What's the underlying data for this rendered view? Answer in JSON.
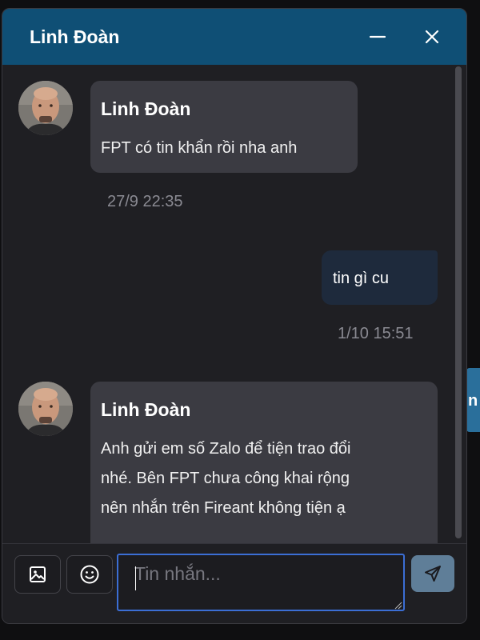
{
  "header": {
    "title": "Linh Đoàn",
    "minimize_icon": "minimize-icon",
    "close_icon": "close-icon"
  },
  "messages": [
    {
      "direction": "incoming",
      "sender": "Linh Đoàn",
      "lines": [
        "FPT có tin khẩn rồi nha anh"
      ],
      "time": "27/9 22:35"
    },
    {
      "direction": "outgoing",
      "lines": [
        "tin gì cu"
      ],
      "time": "1/10 15:51"
    },
    {
      "direction": "incoming",
      "sender": "Linh Đoàn",
      "lines": [
        "Anh gửi em số Zalo để tiện trao đổi",
        "nhé. Bên FPT chưa công khai rộng",
        "nên nhắn trên Fireant không tiện ạ"
      ]
    }
  ],
  "composer": {
    "placeholder": "Tin nhắn...",
    "value": "",
    "image_icon": "image-icon",
    "emoji_icon": "emoji-icon",
    "send_icon": "send-icon"
  },
  "background": {
    "peek_text": "n"
  },
  "colors": {
    "header_bg": "#0f4f75",
    "window_bg": "#1f1f23",
    "incoming_bubble": "#3b3b42",
    "outgoing_bubble": "#1e2a3c",
    "input_focus_border": "#3b6ed4",
    "send_button": "#5f7e98"
  }
}
